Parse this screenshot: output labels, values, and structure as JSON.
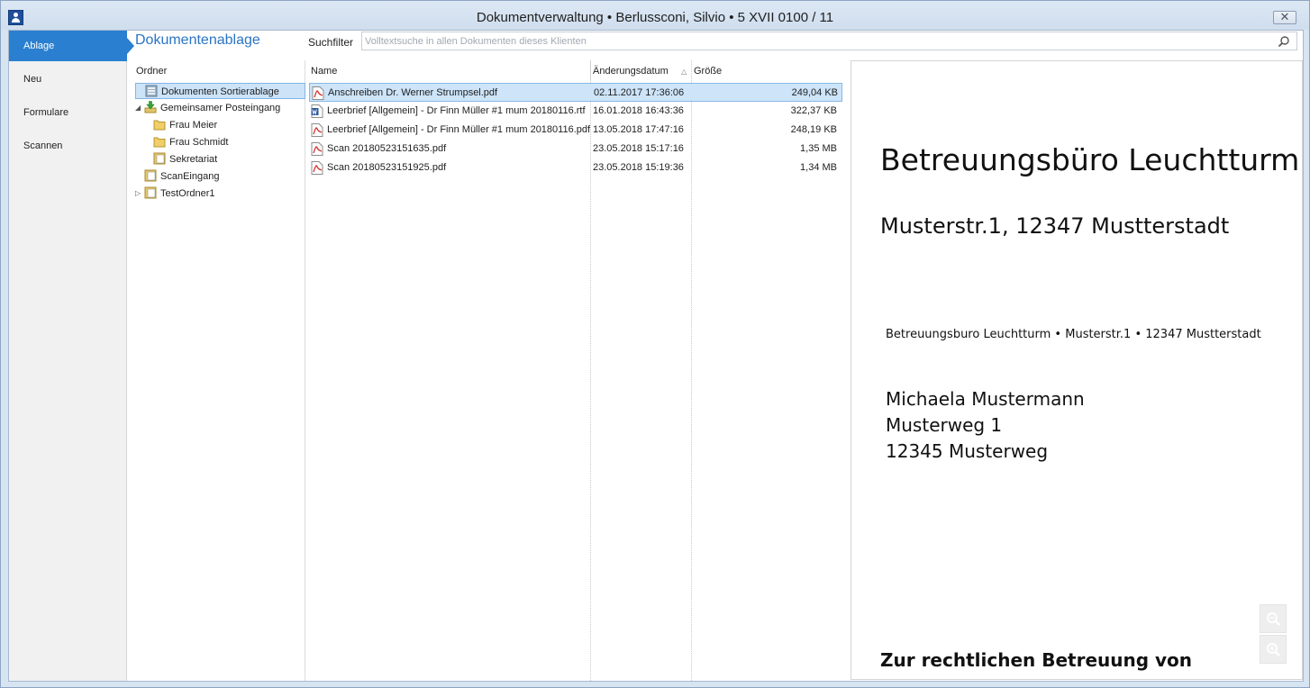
{
  "window": {
    "title": "Dokumentverwaltung  •  Berlussconi, Silvio  •  5 XVII 0100 / 11",
    "close_label": "✕"
  },
  "nav": {
    "items": [
      {
        "label": "Ablage",
        "active": true
      },
      {
        "label": "Neu"
      },
      {
        "label": "Formulare"
      },
      {
        "label": "Scannen"
      }
    ]
  },
  "header": {
    "section_title": "Dokumentenablage",
    "suchfilter_label": "Suchfilter",
    "search_placeholder": "Volltextsuche in allen Dokumenten dieses Klienten",
    "search_value": ""
  },
  "tree": {
    "column_header": "Ordner",
    "items": [
      {
        "label": "Dokumenten Sortierablage",
        "selected": true,
        "icon": "document-folder-icon"
      },
      {
        "label": "Gemeinsamer Posteingang",
        "expanded": true,
        "icon": "inbox-download-icon"
      },
      {
        "label": "Frau Meier",
        "icon": "folder-icon"
      },
      {
        "label": "Frau Schmidt",
        "icon": "folder-icon"
      },
      {
        "label": "Sekretariat",
        "icon": "document-folder-icon"
      },
      {
        "label": "ScanEingang",
        "icon": "document-folder-icon"
      },
      {
        "label": "TestOrdner1",
        "expanded": false,
        "icon": "document-folder-icon"
      }
    ]
  },
  "files": {
    "columns": {
      "name": "Name",
      "date": "Änderungsdatum",
      "size": "Größe"
    },
    "sort_indicator": "△",
    "rows": [
      {
        "name": "Anschreiben Dr. Werner Strumpsel.pdf",
        "date": "02.11.2017 17:36:06",
        "size": "249,04 KB",
        "type": "pdf",
        "selected": true
      },
      {
        "name": "Leerbrief [Allgemein] - Dr Finn Müller #1 mum 20180116.rtf",
        "date": "16.01.2018 16:43:36",
        "size": "322,37 KB",
        "type": "word"
      },
      {
        "name": "Leerbrief [Allgemein] - Dr Finn Müller #1 mum 20180116.pdf",
        "date": "13.05.2018 17:47:16",
        "size": "248,19 KB",
        "type": "pdf"
      },
      {
        "name": "Scan 20180523151635.pdf",
        "date": "23.05.2018 15:17:16",
        "size": "1,35 MB",
        "type": "pdf"
      },
      {
        "name": "Scan 20180523151925.pdf",
        "date": "23.05.2018 15:19:36",
        "size": "1,34 MB",
        "type": "pdf"
      }
    ]
  },
  "preview": {
    "company": "Betreuungsbüro Leuchtturm",
    "address": "Musterstr.1, 12347 Mustterstadt",
    "sender_line": "Betreuungsburo Leuchtturm  • Musterstr.1 • 12347 Mustterstadt",
    "recipient": [
      "Michaela Mustermann",
      "Musterweg 1",
      "12345 Musterweg"
    ],
    "subject": "Zur rechtlichen Betreuung von"
  },
  "colors": {
    "accent": "#2a7fd0",
    "title_blue": "#2a74c4",
    "selection": "#cde4f9"
  }
}
